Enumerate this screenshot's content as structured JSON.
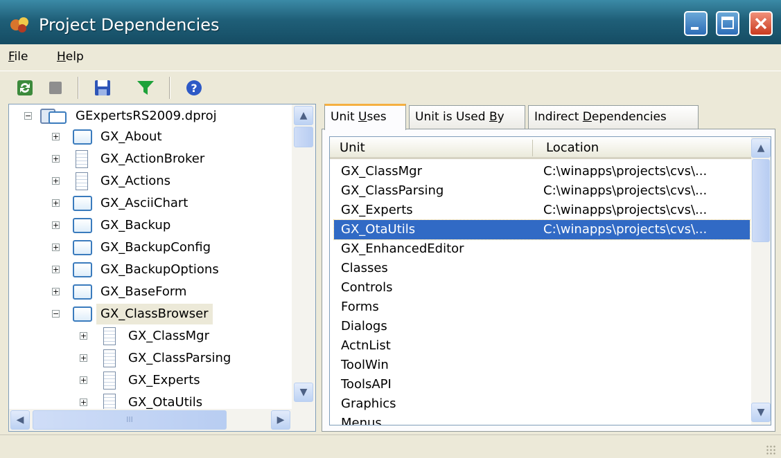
{
  "window": {
    "title": "Project Dependencies",
    "icons": {
      "app": "project-app-icon",
      "minimize": "minimize-icon",
      "maximize": "maximize-icon",
      "close": "close-icon"
    },
    "colors": {
      "titlebar": "#1f5f78",
      "selection": "#316ac5",
      "tab_highlight": "#f5b041"
    }
  },
  "menu": {
    "file": {
      "first": "F",
      "rest": "ile"
    },
    "help": {
      "first": "H",
      "rest": "elp"
    }
  },
  "toolbar": {
    "icons": [
      "refresh-icon",
      "stop-icon",
      "save-icon",
      "filter-icon",
      "help-icon"
    ]
  },
  "tree": {
    "root": "GExpertsRS2009.dproj",
    "items": [
      {
        "label": "GX_About",
        "icon": "form-unit-icon",
        "expander": "+"
      },
      {
        "label": "GX_ActionBroker",
        "icon": "unit-file-icon",
        "expander": "+"
      },
      {
        "label": "GX_Actions",
        "icon": "unit-file-icon",
        "expander": "+"
      },
      {
        "label": "GX_AsciiChart",
        "icon": "form-unit-icon",
        "expander": "+"
      },
      {
        "label": "GX_Backup",
        "icon": "form-unit-icon",
        "expander": "+"
      },
      {
        "label": "GX_BackupConfig",
        "icon": "form-unit-icon",
        "expander": "+"
      },
      {
        "label": "GX_BackupOptions",
        "icon": "form-unit-icon",
        "expander": "+"
      },
      {
        "label": "GX_BaseForm",
        "icon": "form-unit-icon",
        "expander": "+"
      },
      {
        "label": "GX_ClassBrowser",
        "icon": "form-unit-icon",
        "expander": "−",
        "selected": true
      }
    ],
    "children": [
      {
        "label": "GX_ClassMgr",
        "expander": "+"
      },
      {
        "label": "GX_ClassParsing",
        "expander": "+"
      },
      {
        "label": "GX_Experts",
        "expander": "+"
      },
      {
        "label": "GX_OtaUtils",
        "expander": "+"
      }
    ],
    "hscroll_thumb_glyph": "III"
  },
  "tabs": [
    {
      "pre": "Unit ",
      "key": "U",
      "post": "ses",
      "active": true
    },
    {
      "pre": "Unit is Used ",
      "key": "B",
      "post": "y",
      "active": false
    },
    {
      "pre": "Indirect ",
      "key": "D",
      "post": "ependencies",
      "active": false
    }
  ],
  "list": {
    "columns": [
      "Unit",
      "Location"
    ],
    "rows": [
      {
        "unit": "GX_ClassMgr",
        "location": "C:\\winapps\\projects\\cvs\\..."
      },
      {
        "unit": "GX_ClassParsing",
        "location": "C:\\winapps\\projects\\cvs\\..."
      },
      {
        "unit": "GX_Experts",
        "location": "C:\\winapps\\projects\\cvs\\..."
      },
      {
        "unit": "GX_OtaUtils",
        "location": "C:\\winapps\\projects\\cvs\\...",
        "selected": true
      },
      {
        "unit": "GX_EnhancedEditor",
        "location": ""
      },
      {
        "unit": "Classes",
        "location": ""
      },
      {
        "unit": "Controls",
        "location": ""
      },
      {
        "unit": "Forms",
        "location": ""
      },
      {
        "unit": "Dialogs",
        "location": ""
      },
      {
        "unit": "ActnList",
        "location": ""
      },
      {
        "unit": "ToolWin",
        "location": ""
      },
      {
        "unit": "ToolsAPI",
        "location": ""
      },
      {
        "unit": "Graphics",
        "location": ""
      },
      {
        "unit": "Menus",
        "location": ""
      }
    ]
  }
}
